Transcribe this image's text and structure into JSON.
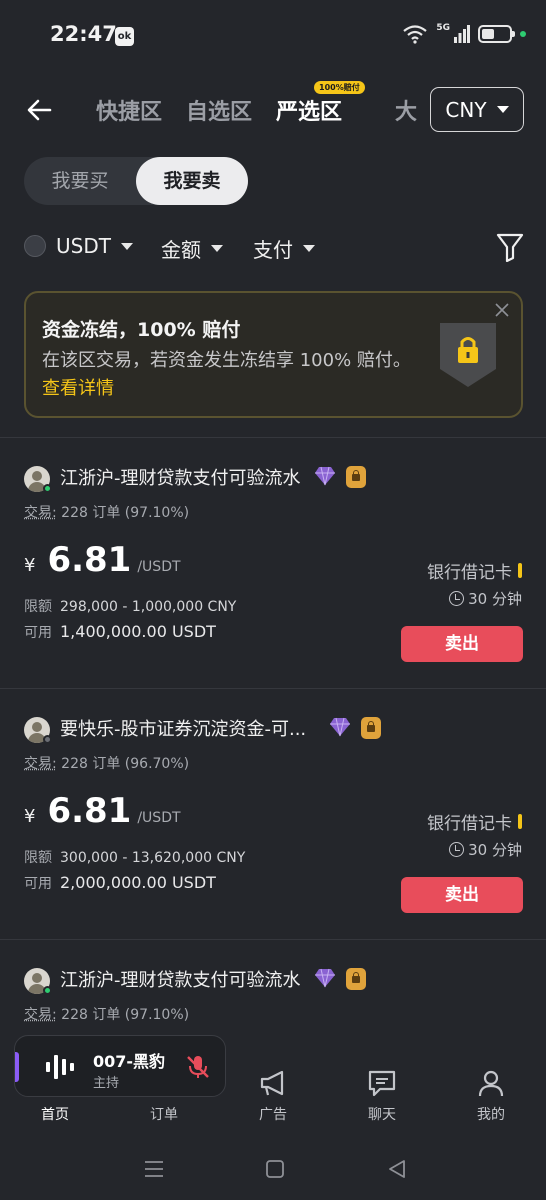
{
  "status_bar": {
    "time": "22:47",
    "app_icon": "ok",
    "network": "5G"
  },
  "header": {
    "tabs": [
      {
        "label": "快捷区",
        "active": false
      },
      {
        "label": "自选区",
        "active": false
      },
      {
        "label": "严选区",
        "active": true,
        "badge": "100%赔付"
      }
    ],
    "tab_more": "大",
    "currency": "CNY"
  },
  "trade_toggle": {
    "buy": "我要买",
    "sell": "我要卖",
    "selected": "sell"
  },
  "filters": {
    "coin": "USDT",
    "amount": "金额",
    "payment": "支付"
  },
  "banner": {
    "title": "资金冻结，100% 赔付",
    "description": "在该区交易，若资金发生冻结享 100% 赔付。",
    "link": "查看详情"
  },
  "listings": [
    {
      "merchant": "江浙沪-理财贷款支付可验流水",
      "online": true,
      "trades_label": "交易:",
      "trades": "228 订单 (97.10%)",
      "currency_symbol": "¥",
      "price": "6.81",
      "price_unit": "/USDT",
      "limit_label": "限额",
      "limit": "298,000 - 1,000,000 CNY",
      "available_label": "可用",
      "available": "1,400,000.00 USDT",
      "payment_method": "银行借记卡",
      "time_limit": "30 分钟",
      "action": "卖出"
    },
    {
      "merchant": "要快乐-股市证券沉淀资金-可...",
      "online": false,
      "trades_label": "交易:",
      "trades": "228 订单 (96.70%)",
      "currency_symbol": "¥",
      "price": "6.81",
      "price_unit": "/USDT",
      "limit_label": "限额",
      "limit": "300,000 - 13,620,000 CNY",
      "available_label": "可用",
      "available": "2,000,000.00 USDT",
      "payment_method": "银行借记卡",
      "time_limit": "30 分钟",
      "action": "卖出"
    },
    {
      "merchant": "江浙沪-理财贷款支付可验流水",
      "online": true,
      "trades_label": "交易:",
      "trades": "228 订单 (97.10%)"
    }
  ],
  "live_player": {
    "name": "007-黑豹",
    "role": "主持"
  },
  "bottom_nav": [
    {
      "label": "首页",
      "icon": "home-icon",
      "active": true
    },
    {
      "label": "订单",
      "icon": "orders-icon",
      "active": false
    },
    {
      "label": "广告",
      "icon": "megaphone-icon",
      "active": false
    },
    {
      "label": "聊天",
      "icon": "chat-icon",
      "active": false
    },
    {
      "label": "我的",
      "icon": "profile-icon",
      "active": false
    }
  ],
  "colors": {
    "background": "#24262b",
    "accent_yellow": "#f5c518",
    "sell_red": "#e84d5b",
    "online_green": "#2ecc71",
    "live_purple": "#8b5cf6"
  }
}
